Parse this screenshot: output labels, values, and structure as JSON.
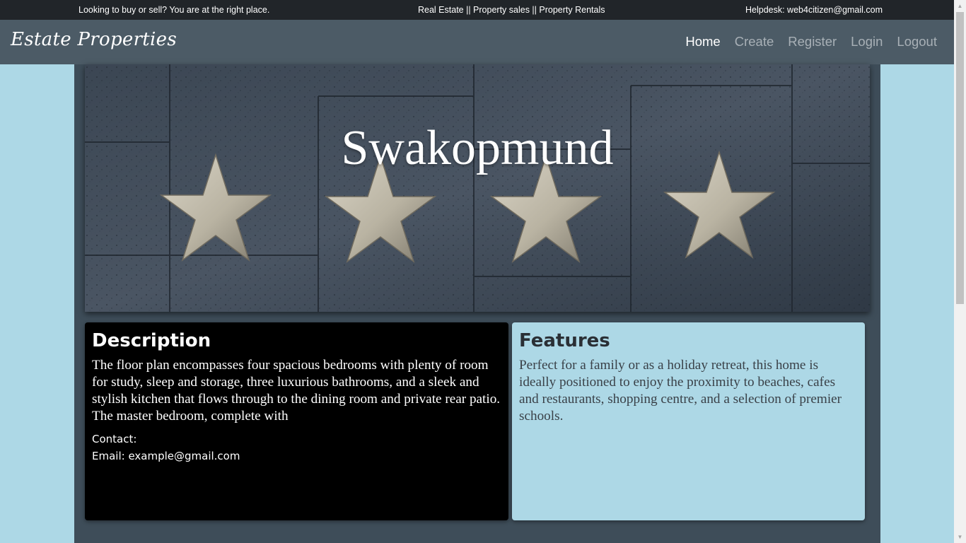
{
  "topbar": {
    "left_text": "Looking to buy or sell? You are at the right place.",
    "center_text": "Real Estate || Property sales || Property Rentals",
    "right_text": "Helpdesk: web4citizen@gmail.com"
  },
  "navbar": {
    "brand": "Estate Properties",
    "links": [
      {
        "label": "Home",
        "active": true
      },
      {
        "label": "Create",
        "active": false
      },
      {
        "label": "Register",
        "active": false
      },
      {
        "label": "Login",
        "active": false
      },
      {
        "label": "Logout",
        "active": false
      }
    ]
  },
  "hero": {
    "title": "Swakopmund"
  },
  "description": {
    "heading": "Description",
    "body": "The floor plan encompasses four spacious bedrooms with plenty of room for study, sleep and storage, three luxurious bathrooms, and a sleek and stylish kitchen that flows through to the dining room and private rear patio. The master bedroom, complete with",
    "contact_label": "Contact:",
    "email_line": "Email: example@gmail.com"
  },
  "features": {
    "heading": "Features",
    "body": "Perfect for a family or as a holiday retreat, this home is ideally positioned to enjoy the proximity to beaches, cafes and restaurants, shopping centre, and a selection of premier schools."
  },
  "colors": {
    "page_background": "#add8e6",
    "topbar": "#212529",
    "navbar": "#4c5b66",
    "content_panel": "#3e4d59",
    "description_card": "#000000",
    "features_card": "#add8e6"
  },
  "icons": {
    "scroll_up": "scroll-up-arrow-icon",
    "scroll_down": "scroll-down-arrow-icon",
    "hero_stars": "star-icon"
  }
}
